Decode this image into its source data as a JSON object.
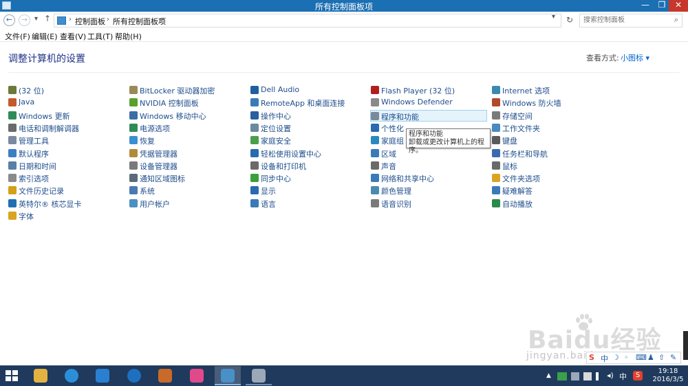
{
  "window": {
    "title": "所有控制面板项"
  },
  "window_buttons": {
    "minimize": "—",
    "maximize": "❐",
    "close": "✕"
  },
  "nav": {
    "back": "←",
    "forward": "→",
    "recent": "▾",
    "up": "↑",
    "breadcrumb": [
      "控制面板",
      "所有控制面板项"
    ],
    "separator": "›",
    "dropdown": "▾",
    "refresh": "↻",
    "search_placeholder": "搜索控制面板",
    "search_icon": "⌕"
  },
  "menu": [
    "文件(F)",
    "编辑(E)",
    "查看(V)",
    "工具(T)",
    "帮助(H)"
  ],
  "content": {
    "title": "调整计算机的设置",
    "view_by_label": "查看方式:",
    "view_by_value": "小图标 ▾"
  },
  "columns": [
    [
      {
        "label": "(32 位)",
        "icon": "gear-icon",
        "color": "#6b7a3a"
      },
      {
        "label": "Java",
        "icon": "java-icon",
        "color": "#c45a2a"
      },
      {
        "label": "Windows 更新",
        "icon": "windows-update-icon",
        "color": "#2e8b57"
      },
      {
        "label": "电话和调制解调器",
        "icon": "phone-modem-icon",
        "color": "#6a6a6a"
      },
      {
        "label": "管理工具",
        "icon": "admin-tools-icon",
        "color": "#7a8aa0"
      },
      {
        "label": "默认程序",
        "icon": "default-programs-icon",
        "color": "#3b7fc4"
      },
      {
        "label": "日期和时间",
        "icon": "clock-icon",
        "color": "#5a7fa8"
      },
      {
        "label": "索引选项",
        "icon": "index-icon",
        "color": "#8a8a8a"
      },
      {
        "label": "文件历史记录",
        "icon": "file-history-icon",
        "color": "#d4a017"
      },
      {
        "label": "英特尔® 核芯显卡",
        "icon": "intel-graphics-icon",
        "color": "#1f6fb3"
      },
      {
        "label": "字体",
        "icon": "fonts-icon",
        "color": "#d9a520"
      }
    ],
    [
      {
        "label": "BitLocker 驱动器加密",
        "icon": "bitlocker-icon",
        "color": "#9a8a5a"
      },
      {
        "label": "NVIDIA 控制面板",
        "icon": "nvidia-icon",
        "color": "#5aa02c"
      },
      {
        "label": "Windows 移动中心",
        "icon": "mobility-center-icon",
        "color": "#3a6ea5"
      },
      {
        "label": "电源选项",
        "icon": "power-icon",
        "color": "#2e8b57"
      },
      {
        "label": "恢复",
        "icon": "recovery-icon",
        "color": "#3b8fd0"
      },
      {
        "label": "凭据管理器",
        "icon": "credential-icon",
        "color": "#b08a3a"
      },
      {
        "label": "设备管理器",
        "icon": "device-manager-icon",
        "color": "#7a7a7a"
      },
      {
        "label": "通知区域图标",
        "icon": "notification-icon",
        "color": "#5a6a7a"
      },
      {
        "label": "系统",
        "icon": "system-icon",
        "color": "#4a7ab0"
      },
      {
        "label": "用户帐户",
        "icon": "user-accounts-icon",
        "color": "#4a90c0"
      }
    ],
    [
      {
        "label": "Dell Audio",
        "icon": "dell-audio-icon",
        "color": "#1f5f9f"
      },
      {
        "label": "RemoteApp 和桌面连接",
        "icon": "remoteapp-icon",
        "color": "#3a7ab8"
      },
      {
        "label": "操作中心",
        "icon": "flag-icon",
        "color": "#2a5fa0"
      },
      {
        "label": "定位设置",
        "icon": "location-icon",
        "color": "#6a8aa0"
      },
      {
        "label": "家庭安全",
        "icon": "family-safety-icon",
        "color": "#4aa04a"
      },
      {
        "label": "轻松使用设置中心",
        "icon": "ease-of-access-icon",
        "color": "#2a6ab0"
      },
      {
        "label": "设备和打印机",
        "icon": "printer-icon",
        "color": "#6a6a6a"
      },
      {
        "label": "同步中心",
        "icon": "sync-icon",
        "color": "#3aa03a"
      },
      {
        "label": "显示",
        "icon": "display-icon",
        "color": "#2a6ab0"
      },
      {
        "label": "语言",
        "icon": "language-icon",
        "color": "#3a7ab8"
      }
    ],
    [
      {
        "label": "Flash Player (32 位)",
        "icon": "flash-icon",
        "color": "#b01e1e"
      },
      {
        "label": "Windows Defender",
        "icon": "defender-icon",
        "color": "#8a8a8a"
      },
      {
        "label": "程序和功能",
        "icon": "programs-icon",
        "color": "#7a8a9a",
        "hover": true
      },
      {
        "label": "个性化",
        "icon": "personalization-icon",
        "color": "#2a6ab0"
      },
      {
        "label": "家庭组",
        "icon": "homegroup-icon",
        "color": "#2a8ac0"
      },
      {
        "label": "区域",
        "icon": "region-icon",
        "color": "#3a7ab8"
      },
      {
        "label": "声音",
        "icon": "sound-icon",
        "color": "#6a6a6a"
      },
      {
        "label": "网络和共享中心",
        "icon": "network-icon",
        "color": "#3a7ab8"
      },
      {
        "label": "颜色管理",
        "icon": "color-management-icon",
        "color": "#4a8ab0"
      },
      {
        "label": "语音识别",
        "icon": "microphone-icon",
        "color": "#7a7a7a"
      }
    ],
    [
      {
        "label": "Internet 选项",
        "icon": "internet-options-icon",
        "color": "#3a8ab0"
      },
      {
        "label": "Windows 防火墙",
        "icon": "firewall-icon",
        "color": "#b04a2a"
      },
      {
        "label": "存储空间",
        "icon": "storage-icon",
        "color": "#7a7a7a"
      },
      {
        "label": "工作文件夹",
        "icon": "work-folders-icon",
        "color": "#4a8ac0"
      },
      {
        "label": "键盘",
        "icon": "keyboard-icon",
        "color": "#5a5a5a"
      },
      {
        "label": "任务栏和导航",
        "icon": "taskbar-icon",
        "color": "#3a6ab0"
      },
      {
        "label": "鼠标",
        "icon": "mouse-icon",
        "color": "#6a6a6a"
      },
      {
        "label": "文件夹选项",
        "icon": "folder-options-icon",
        "color": "#d9a520"
      },
      {
        "label": "疑难解答",
        "icon": "troubleshoot-icon",
        "color": "#3a7ab8"
      },
      {
        "label": "自动播放",
        "icon": "autoplay-icon",
        "color": "#2a8a4a"
      }
    ]
  ],
  "tooltip": {
    "line1": "程序和功能",
    "line2": "卸载或更改计算机上的程序。"
  },
  "watermark": {
    "text": "Baidu经验",
    "sub": "jingyan.baidu.com"
  },
  "taskbar": {
    "apps": [
      {
        "name": "file-explorer",
        "color": "#e3b341",
        "state": ""
      },
      {
        "name": "internet-explorer",
        "color": "#2a8fd8",
        "state": ""
      },
      {
        "name": "mail-app",
        "color": "#2a7fd0",
        "state": ""
      },
      {
        "name": "k-app",
        "color": "#1f6fc0",
        "state": ""
      },
      {
        "name": "paint-app",
        "color": "#c96a2a",
        "state": ""
      },
      {
        "name": "flower-app",
        "color": "#e04a8a",
        "state": ""
      },
      {
        "name": "control-panel",
        "color": "#4a90c8",
        "state": "active"
      },
      {
        "name": "recycle-app",
        "color": "#9aa8b8",
        "state": "open"
      }
    ],
    "tray": {
      "up_arrow": "▲",
      "lang": "中",
      "ime": "S",
      "time": "19:18",
      "date": "2016/3/5"
    }
  },
  "ime_toolbar": [
    "S",
    "中",
    "☽",
    "◦",
    "⌨",
    "♟",
    "⇧",
    "✎"
  ]
}
